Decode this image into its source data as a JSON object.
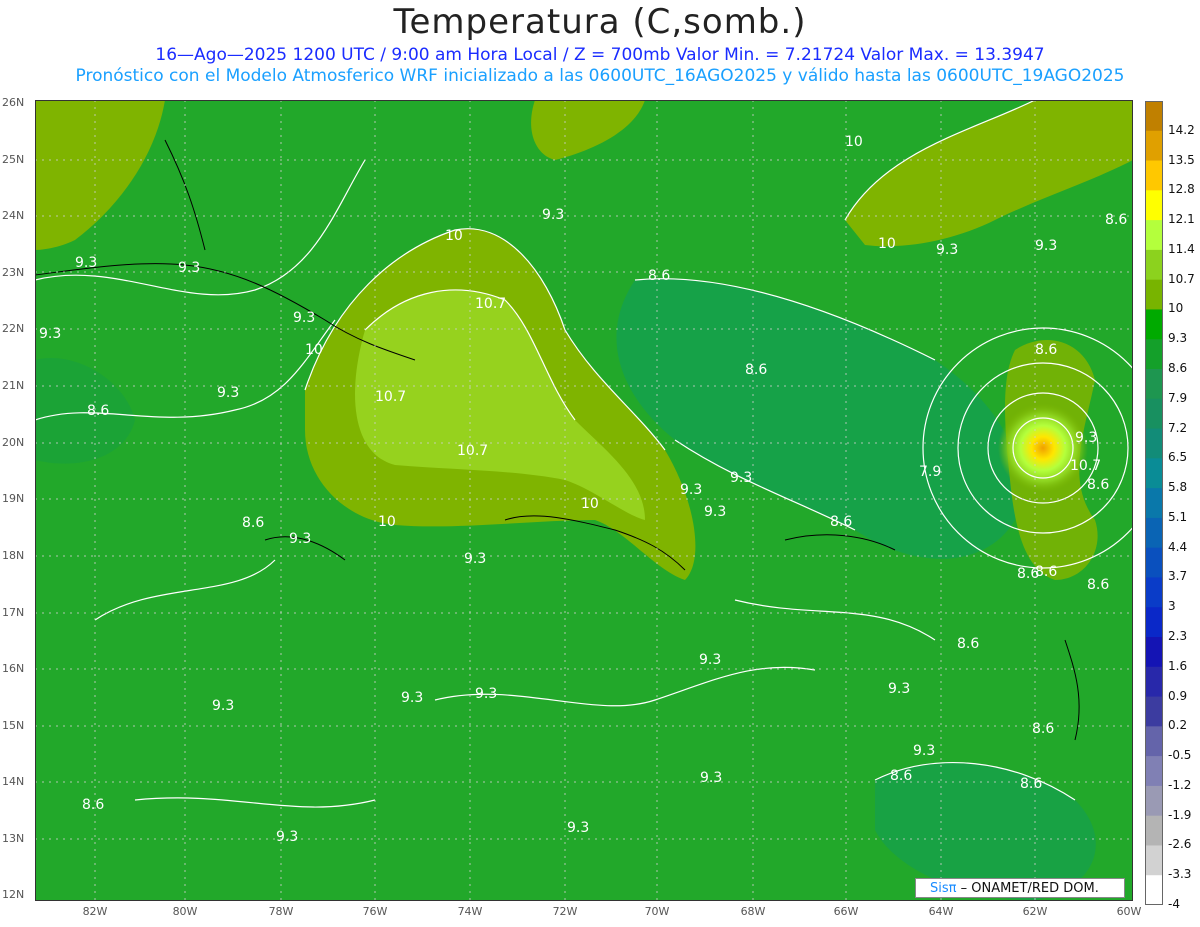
{
  "title": "Temperatura (C,somb.)",
  "subtitle_line1": "16—Ago—2025   1200 UTC / 9:00 am Hora Local / Z = 700mb     Valor Min. = 7.21724  Valor Max. = 13.3947",
  "subtitle_line2": "Pronóstico con el Modelo Atmosferico WRF inicializado a las 0600UTC_16AGO2025 y válido hasta las  0600UTC_19AGO2025",
  "y_axis_labels": [
    "26N",
    "25N",
    "24N",
    "23N",
    "22N",
    "21N",
    "20N",
    "19N",
    "18N",
    "17N",
    "16N",
    "15N",
    "14N",
    "13N",
    "12N"
  ],
  "x_axis_labels": [
    "82W",
    "80W",
    "78W",
    "76W",
    "74W",
    "72W",
    "70W",
    "68W",
    "66W",
    "64W",
    "62W",
    "60W"
  ],
  "colorbar_labels": [
    "14.2",
    "13.5",
    "12.8",
    "12.1",
    "11.4",
    "10.7",
    "10",
    "9.3",
    "8.6",
    "7.9",
    "7.2",
    "6.5",
    "5.8",
    "5.1",
    "4.4",
    "3.7",
    "3",
    "2.3",
    "1.6",
    "0.9",
    "0.2",
    "-0.5",
    "-1.2",
    "-1.9",
    "-2.6",
    "-3.3",
    "-4"
  ],
  "colorbar_colors": [
    "#c08000",
    "#e0a000",
    "#ffc800",
    "#ffff00",
    "#b4ff3c",
    "#8cd21e",
    "#78b400",
    "#00aa00",
    "#14a02a",
    "#1e9650",
    "#189060",
    "#128c78",
    "#0a8c96",
    "#0a78aa",
    "#0a64b4",
    "#0a50be",
    "#0a3cc8",
    "#0a28c8",
    "#1414b4",
    "#2828aa",
    "#3c3ca0",
    "#6464aa",
    "#8080b4",
    "#9a9ab4",
    "#b4b4b4",
    "#d2d2d2",
    "#ffffff"
  ],
  "contour_labels": [
    "10",
    "9.3",
    "8.6",
    "10.7",
    "7.9",
    "9.3",
    "10",
    "8.6",
    "9.3",
    "10.7",
    "10",
    "8.6",
    "9.3",
    "9.3",
    "8.6",
    "10",
    "9.3",
    "9.3",
    "9.3",
    "8.6",
    "10.7",
    "9.3",
    "10",
    "9.3",
    "8.6",
    "9.3",
    "8.6",
    "9.3",
    "8.6",
    "10",
    "9.3",
    "8.6",
    "8.6",
    "8.6",
    "9.3",
    "9.3",
    "9.3",
    "9.3",
    "9.3",
    "8.6",
    "9.3",
    "8.6",
    "9.3",
    "9.3",
    "9.3",
    "8.6",
    "8.6",
    "8.6",
    "10.7",
    "9.3"
  ],
  "credit": {
    "logo": "Sisπ",
    "text": "– ONAMET/RED DOM."
  },
  "map_colors": {
    "base": "#22a82a",
    "warm": "#7fb400",
    "hot": "#96d21e",
    "cool": "#14a050",
    "core": "#ffe600",
    "coremax": "#f0a000"
  }
}
